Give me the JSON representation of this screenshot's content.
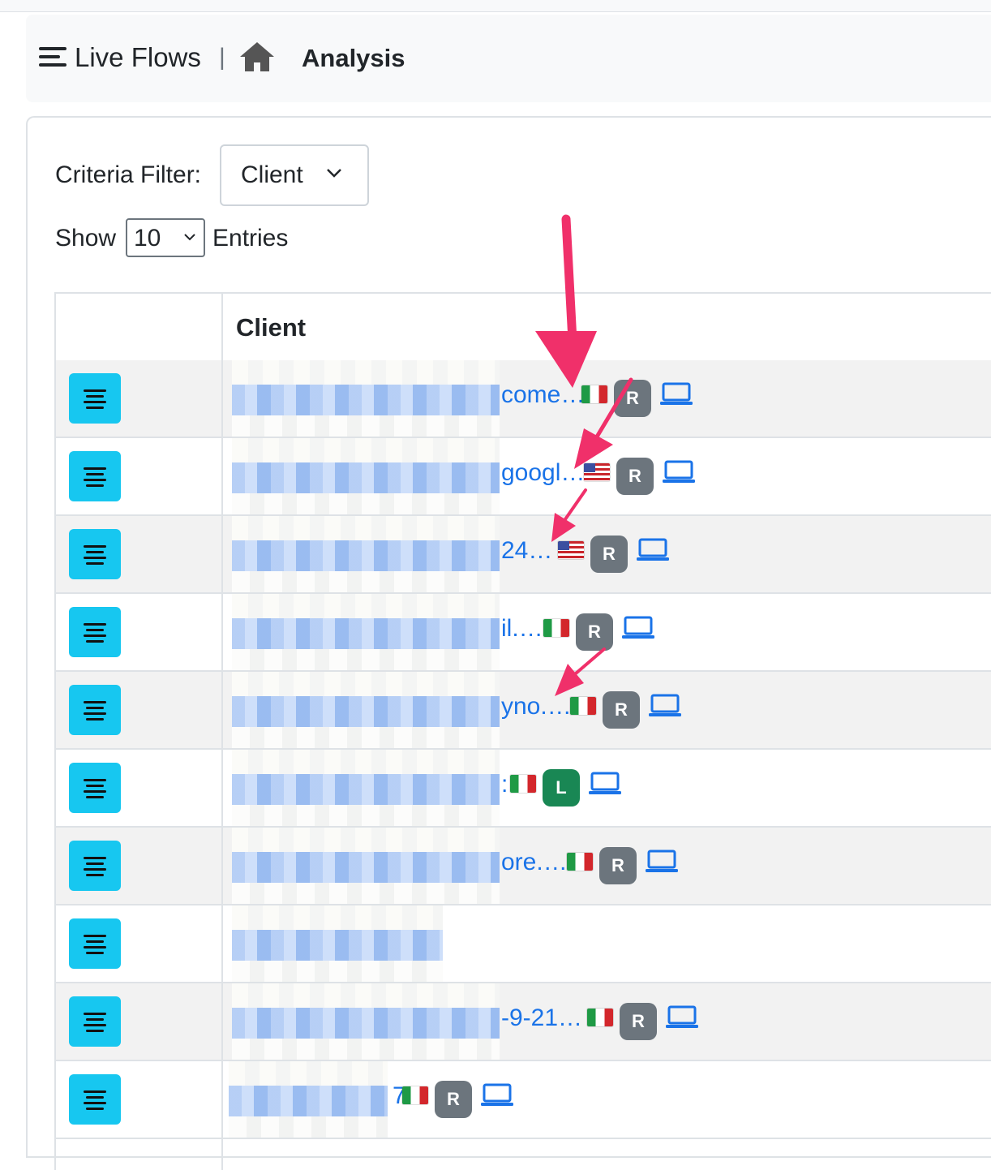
{
  "header": {
    "title": "Live Flows",
    "separator": "|",
    "active": "Analysis"
  },
  "filters": {
    "criteria_label": "Criteria Filter:",
    "criteria_value": "Client",
    "show_label": "Show",
    "show_value": "10",
    "entries_label": "Entries"
  },
  "table": {
    "columns": [
      "",
      "Client"
    ],
    "rows": [
      {
        "client": "come…",
        "flag": "it",
        "badge": "R"
      },
      {
        "client": "googl…",
        "flag": "us",
        "badge": "R"
      },
      {
        "client": "24…",
        "flag": "us",
        "badge": "R"
      },
      {
        "client": "il.…",
        "flag": "it",
        "badge": "R"
      },
      {
        "client": "yno.…",
        "flag": "it",
        "badge": "R"
      },
      {
        "client": ":",
        "flag": "it",
        "badge": "L"
      },
      {
        "client": "ore.…",
        "flag": "it",
        "badge": "R"
      },
      {
        "client": "",
        "flag": "",
        "badge": ""
      },
      {
        "client": "-9-21…",
        "flag": "it",
        "badge": "R"
      },
      {
        "client": "7",
        "flag": "it",
        "badge": "R"
      }
    ]
  },
  "colors": {
    "row_button": "#17c7f0",
    "link": "#1a73e8",
    "badge_remote": "#6c757d",
    "badge_local": "#198754",
    "annotation_arrow": "#f0306a"
  },
  "icons": {
    "menu": "hamburger-icon",
    "home": "home-icon",
    "row_action": "align-center-icon",
    "device": "laptop-icon"
  }
}
